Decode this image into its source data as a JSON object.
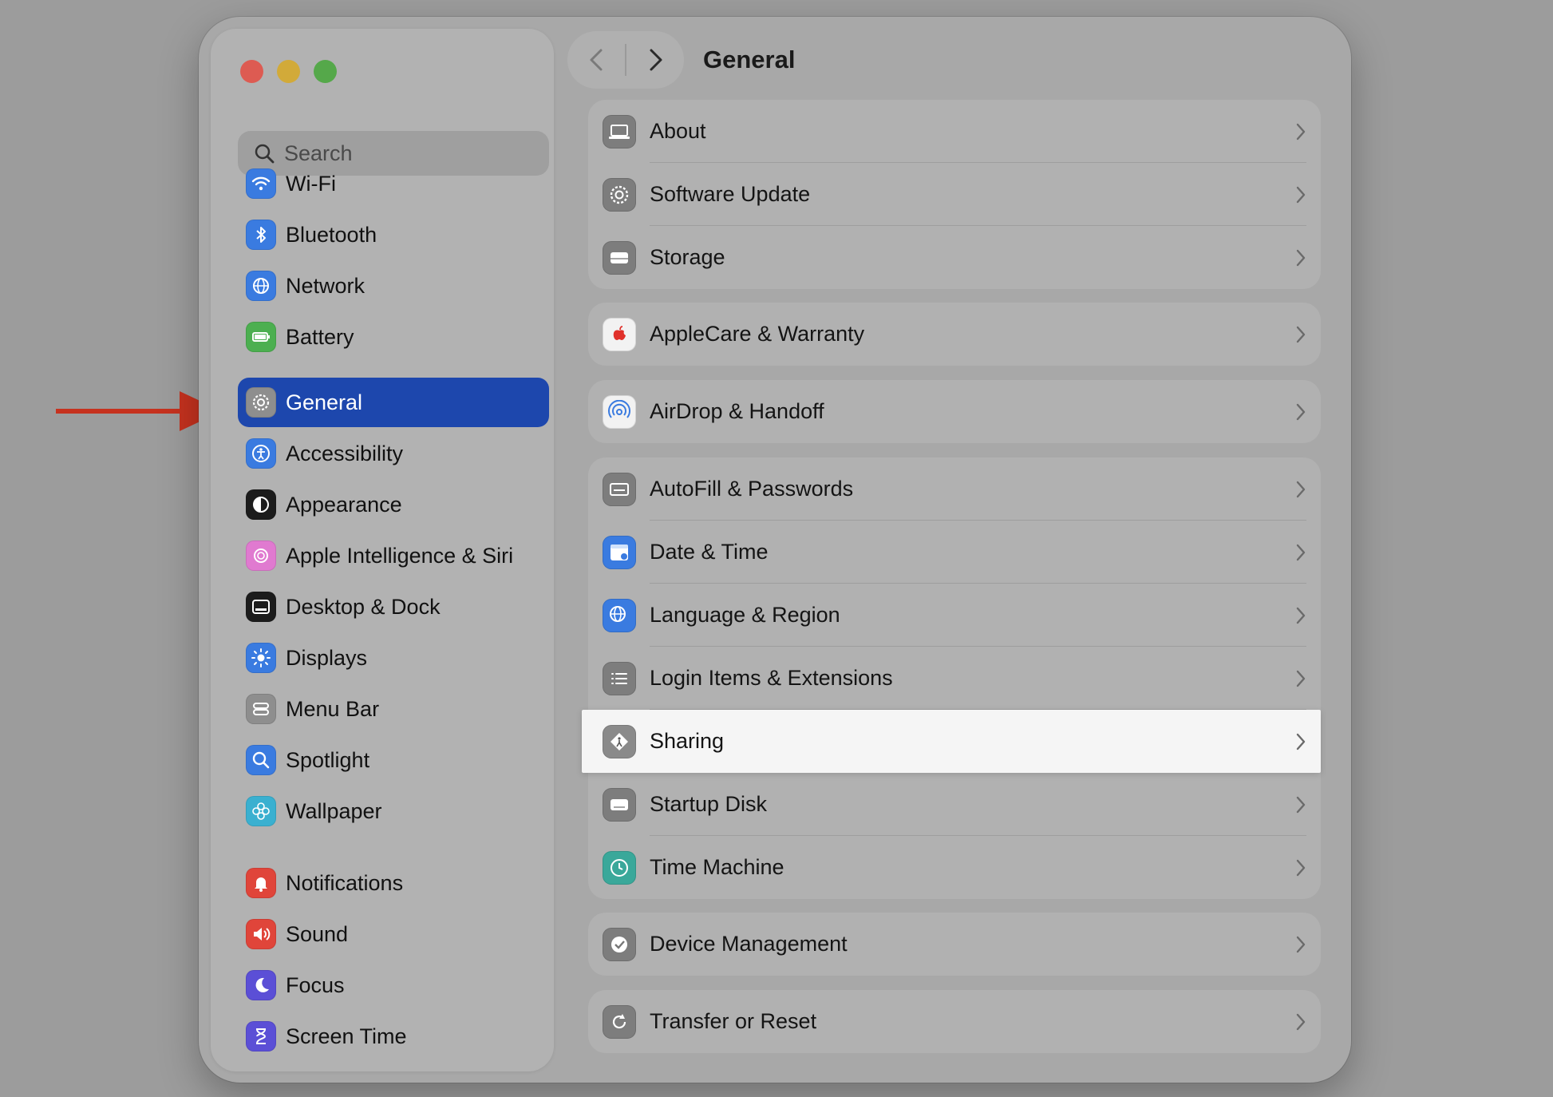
{
  "window": {
    "title": "General"
  },
  "search": {
    "placeholder": "Search"
  },
  "sidebar": {
    "items": [
      {
        "label": "Wi-Fi",
        "icon": "wifi-icon",
        "color": "#3a7be0"
      },
      {
        "label": "Bluetooth",
        "icon": "bluetooth-icon",
        "color": "#3a7be0"
      },
      {
        "label": "Network",
        "icon": "globe-icon",
        "color": "#3a7be0"
      },
      {
        "label": "Battery",
        "icon": "battery-icon",
        "color": "#4caf50"
      },
      {
        "label": "General",
        "icon": "gear-icon",
        "color": "#8e8e8e",
        "selected": true
      },
      {
        "label": "Accessibility",
        "icon": "accessibility-icon",
        "color": "#3a7be0"
      },
      {
        "label": "Appearance",
        "icon": "appearance-icon",
        "color": "#1c1c1c"
      },
      {
        "label": "Apple Intelligence & Siri",
        "icon": "siri-icon",
        "color": "#e07ad0"
      },
      {
        "label": "Desktop & Dock",
        "icon": "dock-icon",
        "color": "#1c1c1c"
      },
      {
        "label": "Displays",
        "icon": "sun-icon",
        "color": "#3a7be0"
      },
      {
        "label": "Menu Bar",
        "icon": "menu-bar-icon",
        "color": "#8e8e8e"
      },
      {
        "label": "Spotlight",
        "icon": "magnifier-icon",
        "color": "#3a7be0"
      },
      {
        "label": "Wallpaper",
        "icon": "flower-icon",
        "color": "#3ab0d0"
      },
      {
        "label": "Notifications",
        "icon": "bell-icon",
        "color": "#e0453a"
      },
      {
        "label": "Sound",
        "icon": "speaker-icon",
        "color": "#e0453a"
      },
      {
        "label": "Focus",
        "icon": "moon-icon",
        "color": "#5b4fd6"
      },
      {
        "label": "Screen Time",
        "icon": "hourglass-icon",
        "color": "#5b4fd6"
      }
    ]
  },
  "content": {
    "groups": [
      [
        {
          "label": "About",
          "icon": "laptop-icon"
        },
        {
          "label": "Software Update",
          "icon": "gear-badge-icon"
        },
        {
          "label": "Storage",
          "icon": "drive-icon"
        }
      ],
      [
        {
          "label": "AppleCare & Warranty",
          "icon": "apple-icon"
        }
      ],
      [
        {
          "label": "AirDrop & Handoff",
          "icon": "airdrop-icon"
        }
      ],
      [
        {
          "label": "AutoFill & Passwords",
          "icon": "keyboard-icon"
        },
        {
          "label": "Date & Time",
          "icon": "calendar-icon"
        },
        {
          "label": "Language & Region",
          "icon": "globe-icon"
        },
        {
          "label": "Login Items & Extensions",
          "icon": "list-icon"
        },
        {
          "label": "Sharing",
          "icon": "sharing-icon",
          "highlighted": true
        },
        {
          "label": "Startup Disk",
          "icon": "disk-icon"
        },
        {
          "label": "Time Machine",
          "icon": "clock-icon"
        }
      ],
      [
        {
          "label": "Device Management",
          "icon": "checkmark-seal-icon"
        }
      ],
      [
        {
          "label": "Transfer or Reset",
          "icon": "reset-icon"
        }
      ]
    ]
  },
  "colors": {
    "selection": "#1d47ad",
    "annotation_arrow": "#c6321f",
    "highlight_row": "#f5f5f5"
  }
}
